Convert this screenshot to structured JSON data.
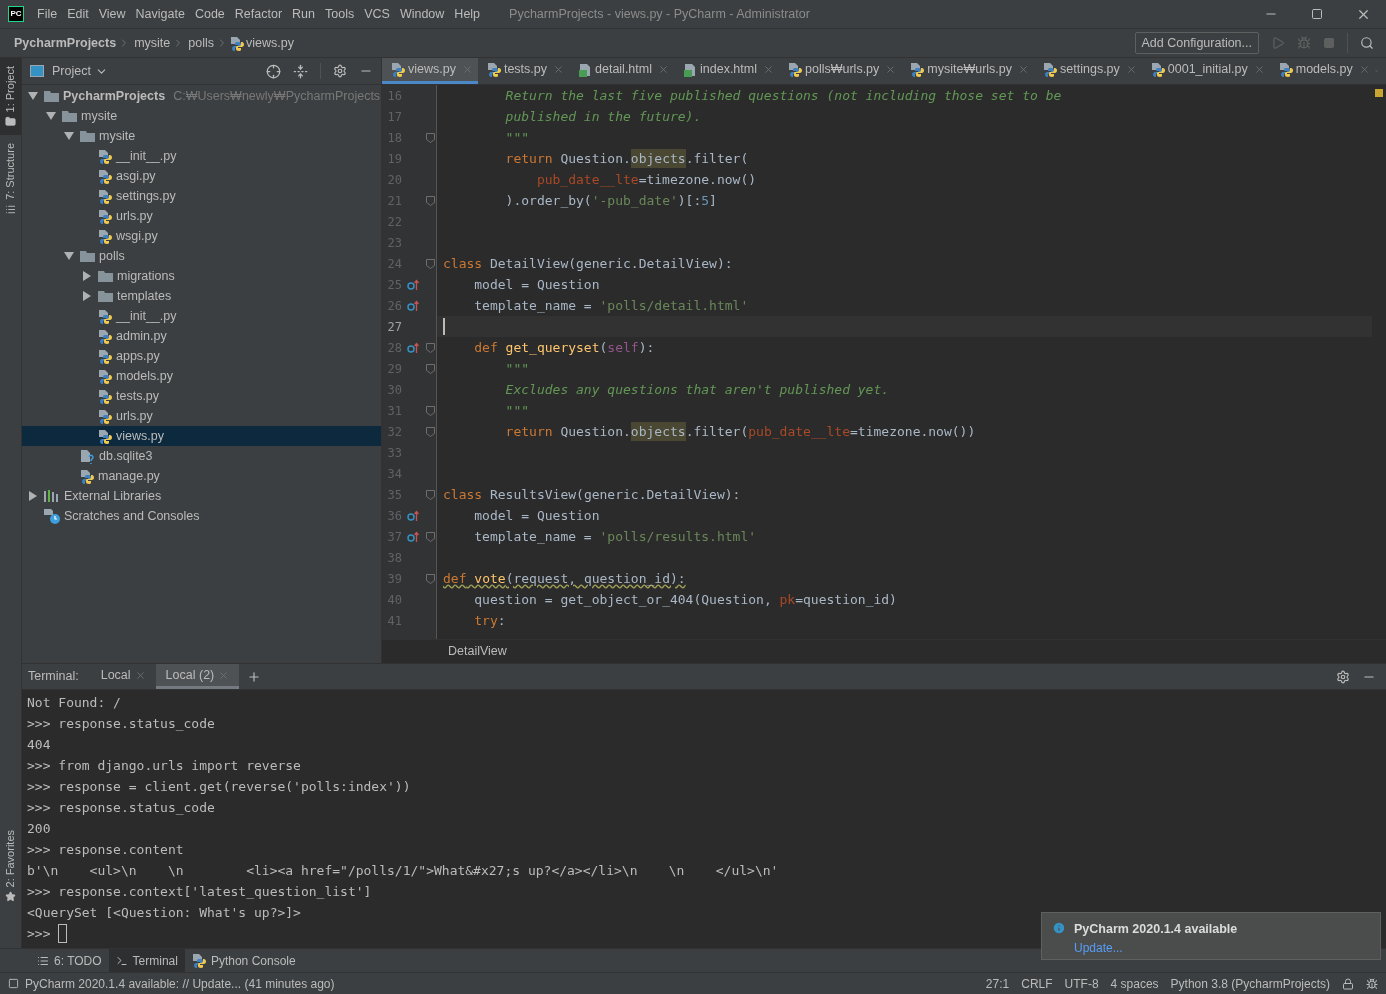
{
  "window": {
    "title": "PycharmProjects - views.py - PyCharm - Administrator",
    "logo": "PC"
  },
  "menu": [
    "File",
    "Edit",
    "View",
    "Navigate",
    "Code",
    "Refactor",
    "Run",
    "Tools",
    "VCS",
    "Window",
    "Help"
  ],
  "breadcrumb": [
    "PycharmProjects",
    "mysite",
    "polls",
    "views.py"
  ],
  "run_config": "Add Configuration...",
  "tool_strip": [
    {
      "label": "1: Project",
      "selected": true
    },
    {
      "label": "7: Structure",
      "selected": false
    }
  ],
  "favorites_strip": "2: Favorites",
  "project_panel": {
    "title": "Project",
    "tree": [
      {
        "label": "PycharmProjects",
        "kind": "folder",
        "bold": true,
        "path": "C:₩Users₩newly₩PycharmProjects",
        "expanded": true,
        "selected": false,
        "children": [
          {
            "label": "mysite",
            "kind": "folder",
            "expanded": true,
            "selected": false,
            "children": [
              {
                "label": "mysite",
                "kind": "folder",
                "expanded": true,
                "selected": false,
                "children": [
                  {
                    "label": "__init__.py",
                    "kind": "python",
                    "selected": false
                  },
                  {
                    "label": "asgi.py",
                    "kind": "python",
                    "selected": false
                  },
                  {
                    "label": "settings.py",
                    "kind": "python",
                    "selected": false
                  },
                  {
                    "label": "urls.py",
                    "kind": "python",
                    "selected": false
                  },
                  {
                    "label": "wsgi.py",
                    "kind": "python",
                    "selected": false
                  }
                ]
              },
              {
                "label": "polls",
                "kind": "folder",
                "expanded": true,
                "selected": false,
                "children": [
                  {
                    "label": "migrations",
                    "kind": "folder",
                    "expanded": false,
                    "selected": false
                  },
                  {
                    "label": "templates",
                    "kind": "folder",
                    "expanded": false,
                    "selected": false
                  },
                  {
                    "label": "__init__.py",
                    "kind": "python",
                    "selected": false
                  },
                  {
                    "label": "admin.py",
                    "kind": "python",
                    "selected": false
                  },
                  {
                    "label": "apps.py",
                    "kind": "python",
                    "selected": false
                  },
                  {
                    "label": "models.py",
                    "kind": "python",
                    "selected": false
                  },
                  {
                    "label": "tests.py",
                    "kind": "python",
                    "selected": false
                  },
                  {
                    "label": "urls.py",
                    "kind": "python",
                    "selected": false
                  },
                  {
                    "label": "views.py",
                    "kind": "python",
                    "selected": true
                  }
                ]
              },
              {
                "label": "db.sqlite3",
                "kind": "db",
                "selected": false
              },
              {
                "label": "manage.py",
                "kind": "python",
                "selected": false
              }
            ]
          }
        ]
      },
      {
        "label": "External Libraries",
        "kind": "library",
        "expanded": false,
        "selected": false
      },
      {
        "label": "Scratches and Consoles",
        "kind": "scratch",
        "selected": false
      }
    ]
  },
  "editor_tabs": [
    {
      "label": "views.py",
      "kind": "python",
      "selected": true
    },
    {
      "label": "tests.py",
      "kind": "python",
      "selected": false
    },
    {
      "label": "detail.html",
      "kind": "html",
      "selected": false
    },
    {
      "label": "index.html",
      "kind": "html",
      "selected": false
    },
    {
      "label": "polls₩urls.py",
      "kind": "python",
      "selected": false
    },
    {
      "label": "mysite₩urls.py",
      "kind": "python",
      "selected": false
    },
    {
      "label": "settings.py",
      "kind": "python",
      "selected": false
    },
    {
      "label": "0001_initial.py",
      "kind": "python",
      "selected": false
    },
    {
      "label": "models.py",
      "kind": "python",
      "selected": false
    }
  ],
  "code": [
    {
      "children": [
        {
          "children": [
            {
              "n": "16",
              "tokens": [
                {
                  "kind": "doc",
                  "text": "Return the last five published questions (not including those set to be"
                }
              ]
            },
            {
              "n": "17",
              "tokens": [
                {
                  "kind": "doc",
                  "text": "published in the future)."
                }
              ]
            },
            {
              "n": "18",
              "fold": true,
              "tokens": [
                {
                  "kind": "doc",
                  "text": "\"\"\""
                }
              ]
            },
            {
              "n": "19",
              "tokens": [
                {
                  "kind": "keyword",
                  "text": "return"
                },
                {
                  "kind": "plain",
                  "text": " Question."
                },
                {
                  "kind": "highlight",
                  "text": "objects"
                },
                {
                  "kind": "plain",
                  "text": ".filter("
                }
              ],
              "children": [
                {
                  "n": "20",
                  "tokens": [
                    {
                      "kind": "param",
                      "text": "pub_date__lte"
                    },
                    {
                      "kind": "plain",
                      "text": "=timezone.now()"
                    }
                  ]
                }
              ]
            },
            {
              "n": "21",
              "fold": true,
              "tokens": [
                {
                  "kind": "plain",
                  "text": ").order_by("
                },
                {
                  "kind": "string",
                  "text": "'-pub_date'"
                },
                {
                  "kind": "plain",
                  "text": ")[:"
                },
                {
                  "kind": "number",
                  "text": "5"
                },
                {
                  "kind": "plain",
                  "text": "]"
                }
              ]
            }
          ]
        }
      ]
    },
    {
      "n": "22"
    },
    {
      "n": "23"
    },
    {
      "n": "24",
      "fold": true,
      "tokens": [
        {
          "kind": "keyword",
          "text": "class"
        },
        {
          "kind": "plain",
          "text": " DetailView(generic.DetailView):"
        }
      ],
      "children": [
        {
          "n": "25",
          "override": true,
          "tokens": [
            {
              "kind": "plain",
              "text": "model = Question"
            }
          ]
        },
        {
          "n": "26",
          "override": true,
          "tokens": [
            {
              "kind": "plain",
              "text": "template_name = "
            },
            {
              "kind": "string",
              "text": "'polls/detail.html'"
            }
          ]
        }
      ]
    },
    {
      "n": "27",
      "current": true
    },
    {
      "children": [
        {
          "n": "28",
          "override": true,
          "fold": true,
          "tokens": [
            {
              "kind": "keyword",
              "text": "def"
            },
            {
              "kind": "fn",
              "text": " get_queryset"
            },
            {
              "kind": "plain",
              "text": "("
            },
            {
              "kind": "self",
              "text": "self"
            },
            {
              "kind": "plain",
              "text": "):"
            }
          ],
          "children": [
            {
              "n": "29",
              "fold": true,
              "tokens": [
                {
                  "kind": "doc",
                  "text": "\"\"\""
                }
              ]
            },
            {
              "n": "30",
              "tokens": [
                {
                  "kind": "doc",
                  "text": "Excludes any questions that aren't published yet."
                }
              ]
            },
            {
              "n": "31",
              "fold": true,
              "tokens": [
                {
                  "kind": "doc",
                  "text": "\"\"\""
                }
              ]
            },
            {
              "n": "32",
              "fold": true,
              "tokens": [
                {
                  "kind": "keyword",
                  "text": "return"
                },
                {
                  "kind": "plain",
                  "text": " Question."
                },
                {
                  "kind": "highlight",
                  "text": "objects"
                },
                {
                  "kind": "plain",
                  "text": ".filter("
                },
                {
                  "kind": "param",
                  "text": "pub_date__lte"
                },
                {
                  "kind": "plain",
                  "text": "=timezone.now())"
                }
              ]
            }
          ]
        }
      ]
    },
    {
      "n": "33"
    },
    {
      "n": "34"
    },
    {
      "n": "35",
      "fold": true,
      "tokens": [
        {
          "kind": "keyword",
          "text": "class"
        },
        {
          "kind": "plain",
          "text": " ResultsView(generic.DetailView):"
        }
      ],
      "children": [
        {
          "n": "36",
          "override": true,
          "tokens": [
            {
              "kind": "plain",
              "text": "model = Question"
            }
          ]
        },
        {
          "n": "37",
          "override": true,
          "fold": true,
          "tokens": [
            {
              "kind": "plain",
              "text": "template_name = "
            },
            {
              "kind": "string",
              "text": "'polls/results.html'"
            }
          ]
        }
      ]
    },
    {
      "n": "38"
    },
    {
      "n": "39",
      "fold": true,
      "tokens": [
        {
          "kind": "warn_keyword",
          "text": "def"
        },
        {
          "kind": "warn_fn",
          "text": " vote"
        },
        {
          "kind": "warn",
          "text": "(request, question_id):"
        }
      ],
      "children": [
        {
          "n": "40",
          "tokens": [
            {
              "kind": "plain",
              "text": "question = get_object_or_404(Question, "
            },
            {
              "kind": "param",
              "text": "pk"
            },
            {
              "kind": "plain",
              "text": "=question_id)"
            }
          ]
        },
        {
          "n": "41",
          "tokens": [
            {
              "kind": "keyword",
              "text": "try"
            },
            {
              "kind": "plain",
              "text": ":"
            }
          ]
        }
      ]
    }
  ],
  "editor_breadcrumb": "DetailView",
  "terminal": {
    "label": "Terminal:",
    "tabs": [
      {
        "label": "Local",
        "selected": false
      },
      {
        "label": "Local (2)",
        "selected": true
      }
    ],
    "lines": [
      "Not Found: /",
      ">>> response.status_code",
      "404",
      ">>> from django.urls import reverse",
      ">>> response = client.get(reverse('polls:index'))",
      ">>> response.status_code",
      "200",
      ">>> response.content",
      "b'\\n    <ul>\\n    \\n        <li><a href=\"/polls/1/\">What&#x27;s up?</a></li>\\n    \\n    </ul>\\n'",
      ">>> response.context['latest_question_list']",
      "<QuerySet [<Question: What's up?>]>"
    ],
    "prompt": ">>>"
  },
  "bottom_tabs": [
    {
      "label": "6: TODO",
      "kind": "todo",
      "selected": false
    },
    {
      "label": "Terminal",
      "kind": "terminal",
      "selected": true
    },
    {
      "label": "Python Console",
      "kind": "python",
      "selected": false
    }
  ],
  "notification": {
    "title": "PyCharm 2020.1.4 available",
    "link": "Update..."
  },
  "status_bar": {
    "message": "PyCharm 2020.1.4 available: // Update... (41 minutes ago)",
    "items": [
      "27:1",
      "CRLF",
      "UTF-8",
      "4 spaces",
      "Python 3.8 (PycharmProjects)"
    ]
  }
}
